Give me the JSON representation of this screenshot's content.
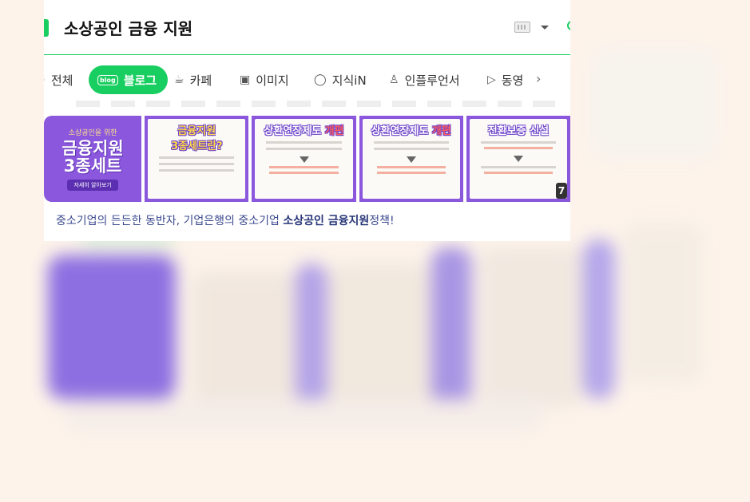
{
  "search": {
    "query": "소상공인 금융 지원"
  },
  "tabs": [
    {
      "label": "전체",
      "icon": "search-icon"
    },
    {
      "label": "블로그",
      "icon": "blog-icon",
      "active": true
    },
    {
      "label": "카페",
      "icon": "cafe-icon"
    },
    {
      "label": "이미지",
      "icon": "image-icon"
    },
    {
      "label": "지식iN",
      "icon": "kin-icon"
    },
    {
      "label": "인플루언서",
      "icon": "person-icon"
    },
    {
      "label": "동영",
      "icon": "play-icon"
    }
  ],
  "thumbnails": {
    "first": {
      "small": "소상공인을 위한",
      "big": "금융지원\n3종세트",
      "button": "자세히 알아보기"
    },
    "second": {
      "title": "금융지원\n3종세트란?"
    },
    "third": {
      "title_a": "상환연장제도 ",
      "title_b": "개편"
    },
    "fourth": {
      "title_a": "상환연장제도 ",
      "title_b": "개편"
    },
    "fifth": {
      "title": "전환보증 신설"
    },
    "count": "7"
  },
  "caption": {
    "before": "중소기업의 든든한 동반자, 기업은행의 중소기업 ",
    "bold": "소상공인 금융지원",
    "after": "정책!"
  },
  "colors": {
    "brand_green": "#19ce60",
    "thumb_purple": "#8b58dd",
    "page_bg": "#fdf3ea"
  }
}
